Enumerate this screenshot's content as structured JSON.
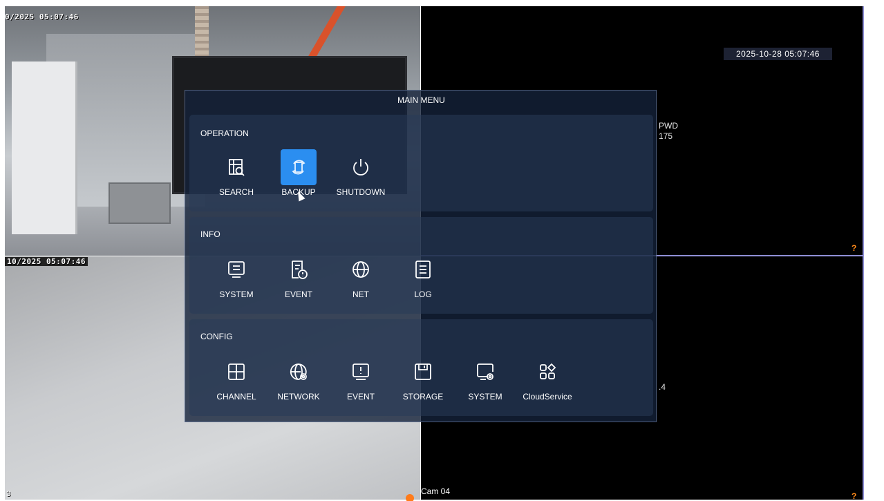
{
  "cameras": {
    "cam1": {
      "osd_time": "0/2025 05:07:46"
    },
    "cam2": {
      "osd_time": "2025-10-28 05:07:46",
      "help": "?",
      "peek_line1": "PWD",
      "peek_line2": "175"
    },
    "cam3": {
      "osd_time": "10/2025  05:07:46",
      "corner_num": "3"
    },
    "cam4": {
      "label": "Cam 04",
      "help": "?",
      "peek": ".4"
    }
  },
  "menu": {
    "title": "MAIN MENU",
    "sections": {
      "operation": {
        "title": "OPERATION",
        "items": [
          {
            "label": "SEARCH",
            "icon": "search-icon"
          },
          {
            "label": "BACKUP",
            "icon": "backup-icon",
            "selected": true
          },
          {
            "label": "SHUTDOWN",
            "icon": "power-icon"
          }
        ]
      },
      "info": {
        "title": "INFO",
        "items": [
          {
            "label": "SYSTEM",
            "icon": "monitor-icon"
          },
          {
            "label": "EVENT",
            "icon": "event-info-icon"
          },
          {
            "label": "NET",
            "icon": "globe-icon"
          },
          {
            "label": "LOG",
            "icon": "log-icon"
          }
        ]
      },
      "config": {
        "title": "CONFIG",
        "items": [
          {
            "label": "CHANNEL",
            "icon": "grid-icon"
          },
          {
            "label": "NETWORK",
            "icon": "network-settings-icon"
          },
          {
            "label": "EVENT",
            "icon": "alert-monitor-icon"
          },
          {
            "label": "STORAGE",
            "icon": "floppy-icon"
          },
          {
            "label": "SYSTEM",
            "icon": "system-settings-icon"
          },
          {
            "label": "CloudService",
            "icon": "apps-icon"
          }
        ]
      }
    }
  },
  "colors": {
    "menu_bg": "#14223a",
    "selected": "#2b8ef0",
    "divider": "#8f8fd6",
    "help": "#ff8a1a"
  }
}
